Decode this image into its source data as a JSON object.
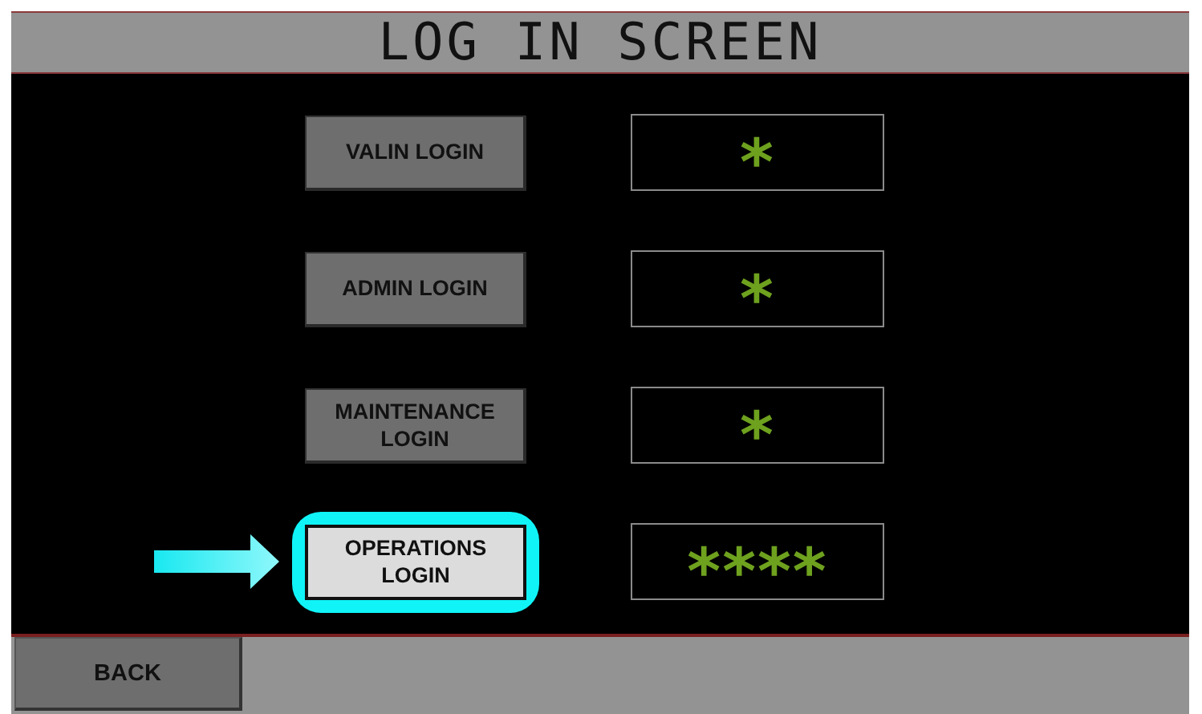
{
  "title": "LOG IN SCREEN",
  "logins": [
    {
      "label": "VALIN LOGIN",
      "value": "*",
      "selected": false
    },
    {
      "label": "ADMIN LOGIN",
      "value": "*",
      "selected": false
    },
    {
      "label": "MAINTENANCE\nLOGIN",
      "value": "*",
      "selected": false
    },
    {
      "label": "OPERATIONS\nLOGIN",
      "value": "****",
      "selected": true
    }
  ],
  "back_button": "BACK"
}
